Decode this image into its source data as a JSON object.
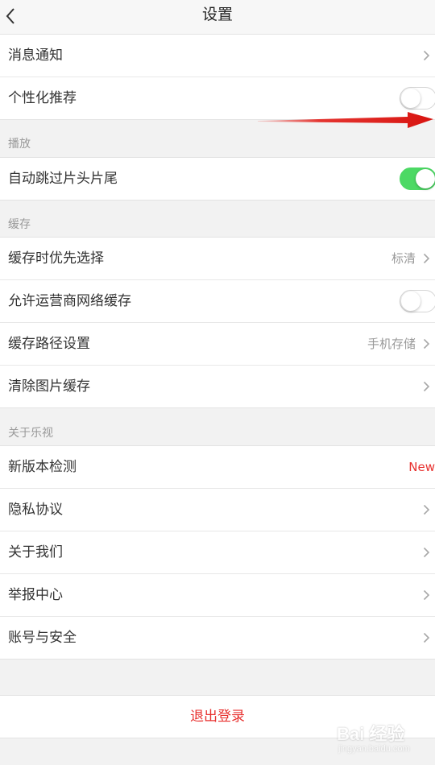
{
  "header": {
    "title": "设置",
    "back_icon": "chevron-left-icon"
  },
  "general": {
    "rows": [
      {
        "label": "消息通知",
        "control": "chevron"
      },
      {
        "label": "个性化推荐",
        "control": "toggle",
        "toggle_on": false
      }
    ]
  },
  "playback": {
    "title": "播放",
    "rows": [
      {
        "label": "自动跳过片头片尾",
        "control": "toggle",
        "toggle_on": true
      }
    ]
  },
  "cache": {
    "title": "缓存",
    "rows": [
      {
        "label": "缓存时优先选择",
        "value": "标清",
        "control": "chevron"
      },
      {
        "label": "允许运营商网络缓存",
        "control": "toggle",
        "toggle_on": false
      },
      {
        "label": "缓存路径设置",
        "value": "手机存储",
        "control": "chevron"
      },
      {
        "label": "清除图片缓存",
        "control": "chevron"
      }
    ]
  },
  "about": {
    "title": "关于乐视",
    "rows": [
      {
        "label": "新版本检测",
        "badge": "New"
      },
      {
        "label": "隐私协议",
        "control": "chevron"
      },
      {
        "label": "关于我们",
        "control": "chevron"
      },
      {
        "label": "举报中心",
        "control": "chevron"
      },
      {
        "label": "账号与安全",
        "control": "chevron"
      }
    ]
  },
  "logout": {
    "label": "退出登录"
  },
  "watermark": {
    "brand": "Bai 经验",
    "url": "jingyan.baidu.com"
  },
  "colors": {
    "accent_red": "#e8312f",
    "toggle_on_green": "#4cd964",
    "annotation_arrow": "#e3201b"
  }
}
